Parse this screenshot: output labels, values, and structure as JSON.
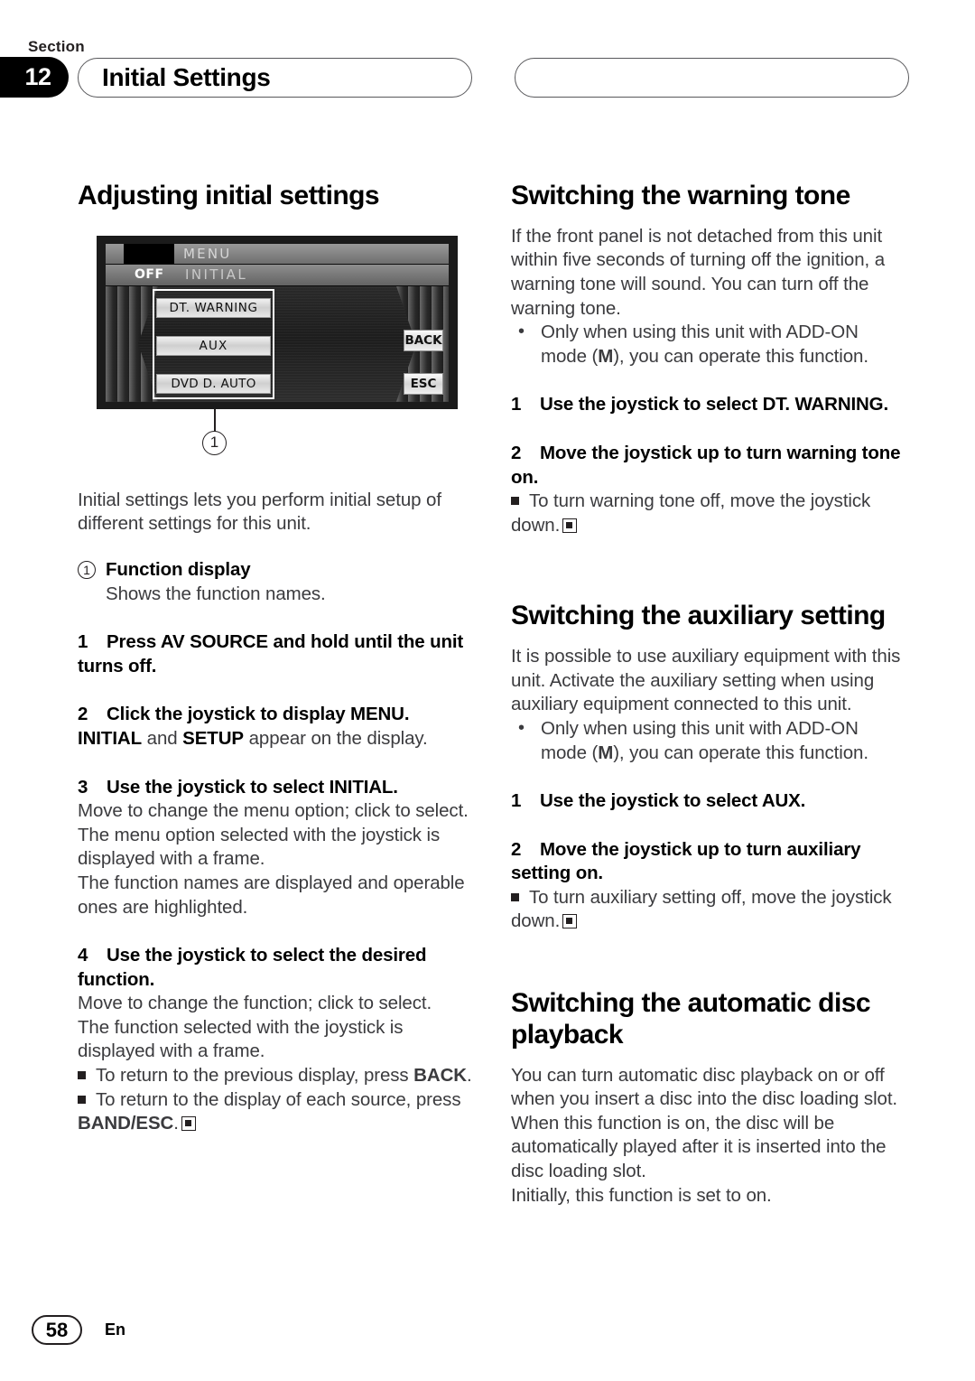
{
  "header": {
    "section_word": "Section",
    "section_number": "12",
    "title": "Initial Settings"
  },
  "left_column": {
    "heading": "Adjusting initial settings",
    "figure": {
      "lcd": {
        "menu_label": "MENU",
        "off_label": "OFF",
        "initial_label": "INITIAL",
        "function_buttons": [
          "DT. WARNING",
          "AUX",
          "DVD D. AUTO"
        ],
        "side_buttons": [
          "BACK",
          "ESC"
        ]
      },
      "callout_number": "1"
    },
    "intro": "Initial settings lets you perform initial setup of different settings for this unit.",
    "callout_item": {
      "marker": "1",
      "title": "Function display",
      "desc": "Shows the function names."
    },
    "steps": [
      {
        "num": "1",
        "title": "Press AV SOURCE and hold until the unit turns off."
      },
      {
        "num": "2",
        "title": "Click the joystick to display MENU.",
        "body_pre": "",
        "body_b1": "INITIAL",
        "body_mid": " and ",
        "body_b2": "SETUP",
        "body_post": " appear on the display."
      },
      {
        "num": "3",
        "title": "Use the joystick to select INITIAL.",
        "paras": [
          "Move to change the menu option; click to select.",
          "The menu option selected with the joystick is displayed with a frame.",
          "The function names are displayed and operable ones are highlighted."
        ]
      },
      {
        "num": "4",
        "title": "Use the joystick to select the desired function.",
        "paras": [
          "Move to change the function; click to select.",
          "The function selected with the joystick is displayed with a frame."
        ],
        "bullets": [
          {
            "pre": "To return to the previous display, press ",
            "bold": "BACK",
            "post": "."
          },
          {
            "pre": "To return to the display of each source, press ",
            "bold": "BAND/ESC",
            "post": "."
          }
        ]
      }
    ]
  },
  "right_column": {
    "sections": [
      {
        "heading": "Switching the warning tone",
        "body": "If the front panel is not detached from this unit within five seconds of turning off the ignition, a warning tone will sound. You can turn off the warning tone.",
        "note_pre": "Only when using this unit with ADD-ON mode (",
        "note_bold": "M",
        "note_post": "), you can operate this function.",
        "steps": [
          {
            "num": "1",
            "title": "Use the joystick to select DT. WARNING."
          },
          {
            "num": "2",
            "title": "Move the joystick up to turn warning tone on."
          }
        ],
        "sub_bullet": "To turn warning tone off, move the joystick down."
      },
      {
        "heading": "Switching the auxiliary setting",
        "body": "It is possible to use auxiliary equipment with this unit. Activate the auxiliary setting when using auxiliary equipment connected to this unit.",
        "note_pre": "Only when using this unit with ADD-ON mode (",
        "note_bold": "M",
        "note_post": "), you can operate this function.",
        "steps": [
          {
            "num": "1",
            "title": "Use the joystick to select AUX."
          },
          {
            "num": "2",
            "title": "Move the joystick up to turn auxiliary setting on."
          }
        ],
        "sub_bullet": "To turn auxiliary setting off, move the joystick down."
      },
      {
        "heading": "Switching the automatic disc playback",
        "body": "You can turn automatic disc playback on or off when you insert a disc into the disc loading slot. When this function is on, the disc will be automatically played after it is inserted into the disc loading slot.",
        "body2": "Initially, this function is set to on."
      }
    ]
  },
  "footer": {
    "page_number": "58",
    "language": "En"
  }
}
